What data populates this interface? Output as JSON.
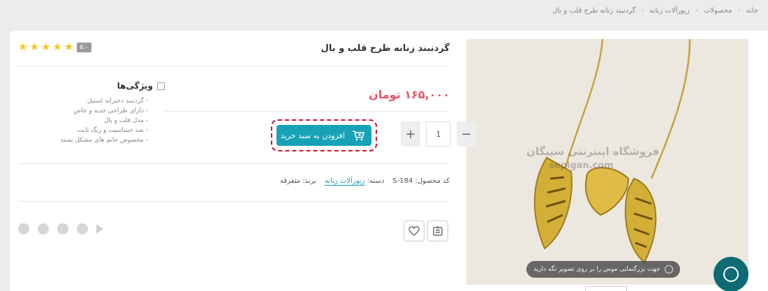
{
  "breadcrumb": [
    "خانه",
    "محصولات",
    "زیورآلات زنانه",
    "گردنبند زنانه طرح قلب و بال"
  ],
  "product": {
    "title": "گردنبند زنانه طرح قلب و بال",
    "price": "۱۶۵,۰۰۰ تومان",
    "rating_badge": "۵.۰",
    "stars": 5,
    "quantity": "1",
    "qty_minus": "−",
    "qty_plus": "+",
    "add_to_cart": "افزودن به سبد خرید",
    "features_title": "ویژگی‌ها",
    "features": [
      "گردنبند دخترانه استیل",
      "دارای طراحی جدید و خاص",
      "مدل قلب و بال",
      "ضد حساسیت و رنگ ثابت",
      "مخصوص خانم های مشکل پسند"
    ],
    "sku_label": "کد محصول:",
    "sku": "S-184",
    "category_label": "دسته:",
    "category": "زیورآلات زنانه",
    "brand_label": "برند:",
    "brand": "متفرقه"
  },
  "gallery": {
    "watermark": "فروشگاه اینترنتی سپیگان",
    "watermark_url": "sepigan.com",
    "zoom_hint": "جهت بزرگنمایی موس را بر روی تصویر نگه دارید"
  },
  "icons": {
    "share": [
      "telegram-icon",
      "facebook-icon",
      "twitter-icon",
      "whatsapp-icon",
      "pinterest-icon"
    ]
  },
  "colors": {
    "accent": "#17a2b8",
    "price": "#e8546a",
    "star": "#f5c518",
    "highlight": "#d0102b",
    "chat": "#0e6b74"
  }
}
